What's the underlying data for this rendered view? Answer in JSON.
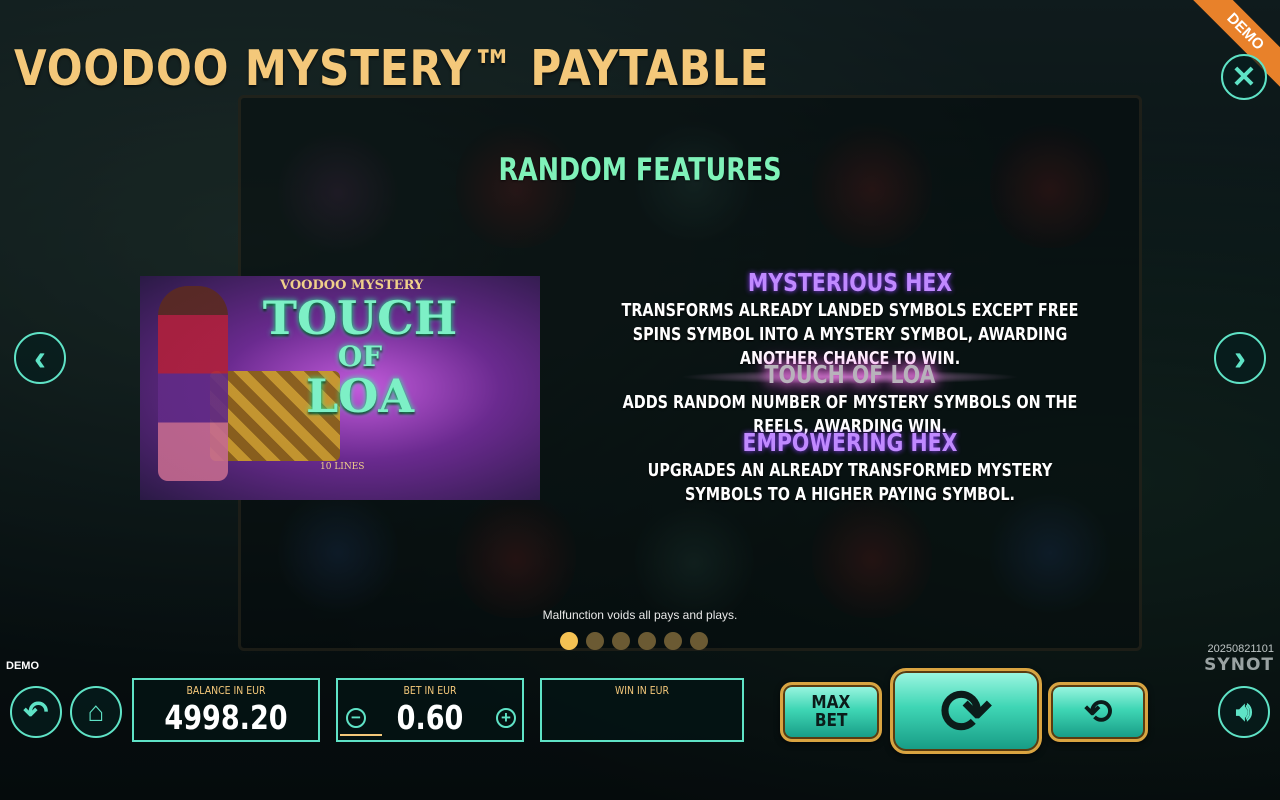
{
  "header": {
    "title": "VOODOO MYSTERY™ PAYTABLE",
    "demo_ribbon": "DEMO"
  },
  "paytable": {
    "section_title": "RANDOM FEATURES",
    "image_label": {
      "brand": "VOODOO MYSTERY",
      "line1": "TOUCH",
      "line2": "OF",
      "line3": "LOA",
      "lines": "10 LINES"
    },
    "features": [
      {
        "title": "MYSTERIOUS HEX",
        "text": "TRANSFORMS ALREADY LANDED SYMBOLS EXCEPT FREE SPINS SYMBOL INTO A MYSTERY SYMBOL, AWARDING ANOTHER CHANCE TO WIN."
      },
      {
        "title": "TOUCH OF LOA",
        "text": "ADDS RANDOM NUMBER OF MYSTERY SYMBOLS ON THE REELS, AWARDING WIN."
      },
      {
        "title": "EMPOWERING HEX",
        "text": "UPGRADES AN ALREADY TRANSFORMED MYSTERY SYMBOLS TO A HIGHER PAYING SYMBOL."
      }
    ],
    "disclaimer": "Malfunction voids all pays and plays.",
    "page_count": 6,
    "current_page": 1
  },
  "footer": {
    "demo_label": "DEMO",
    "version": "20250821101",
    "provider": "SYNOT",
    "balance_label": "BALANCE IN EUR",
    "balance_value": "4998.20",
    "bet_label": "BET IN EUR",
    "bet_value": "0.60",
    "win_label": "WIN IN EUR",
    "win_value": "",
    "max_bet_line1": "MAX",
    "max_bet_line2": "BET"
  },
  "icons": {
    "close": "close-icon",
    "prev": "chevron-left-icon",
    "next": "chevron-right-icon",
    "back": "undo-arrow-icon",
    "home": "home-icon",
    "spin": "spin-arrow-icon",
    "autoplay": "autoplay-icon",
    "sound": "speaker-icon"
  },
  "colors": {
    "title": "#f4c87a",
    "section_title": "#7ff2b9",
    "accent": "#5fe3c6",
    "feature_title": "#c089ff",
    "pager_active": "#f5c253",
    "pager_inactive": "#6b5a33",
    "ribbon": "#e8812a"
  }
}
